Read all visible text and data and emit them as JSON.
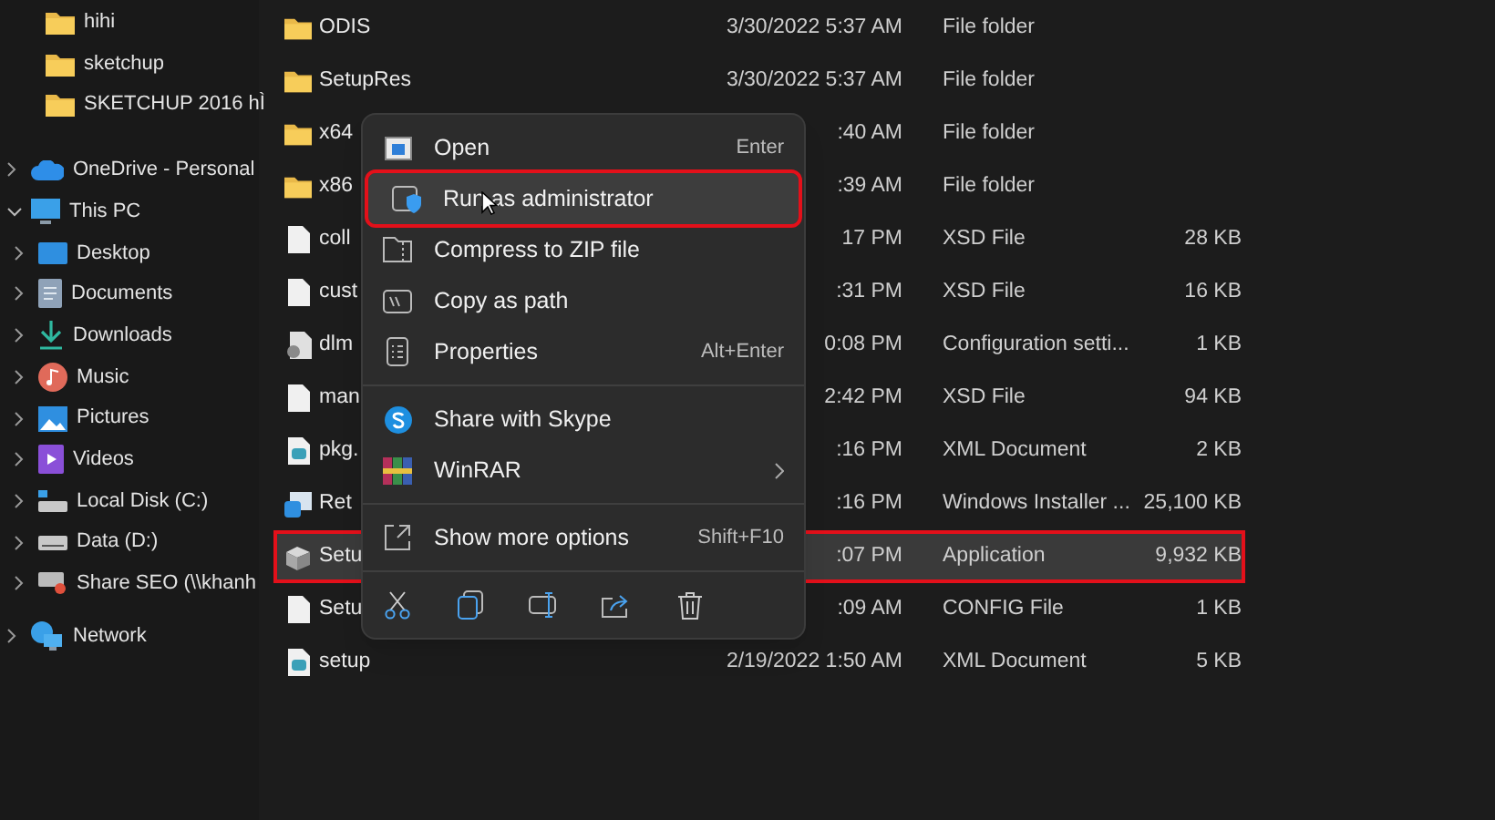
{
  "sidebar": {
    "top_items": [
      {
        "label": "hihi",
        "kind": "folder"
      },
      {
        "label": "sketchup",
        "kind": "folder"
      },
      {
        "label": "SKETCHUP 2016 hÌ",
        "kind": "folder"
      }
    ],
    "items": [
      {
        "label": "OneDrive - Personal",
        "kind": "cloud",
        "expanded": false
      },
      {
        "label": "This PC",
        "kind": "pc",
        "expanded": true,
        "children": [
          {
            "label": "Desktop",
            "kind": "desktop",
            "expanded": false
          },
          {
            "label": "Documents",
            "kind": "documents",
            "expanded": false
          },
          {
            "label": "Downloads",
            "kind": "downloads",
            "expanded": false
          },
          {
            "label": "Music",
            "kind": "music",
            "expanded": false
          },
          {
            "label": "Pictures",
            "kind": "pictures",
            "expanded": false
          },
          {
            "label": "Videos",
            "kind": "videos",
            "expanded": false
          },
          {
            "label": "Local Disk (C:)",
            "kind": "disk",
            "expanded": false
          },
          {
            "label": "Data (D:)",
            "kind": "drive",
            "expanded": false
          },
          {
            "label": "Share SEO (\\\\khanh",
            "kind": "netdrive",
            "expanded": false
          }
        ]
      },
      {
        "label": "Network",
        "kind": "network",
        "expanded": false
      }
    ]
  },
  "files": [
    {
      "name": "ODIS",
      "date": "3/30/2022 5:37 AM",
      "type": "File folder",
      "kind": "folder",
      "selected": false
    },
    {
      "name": "SetupRes",
      "date": "3/30/2022 5:37 AM",
      "type": "File folder",
      "kind": "folder",
      "selected": false
    },
    {
      "name": "x64",
      "date": ":40 AM",
      "type": "File folder",
      "kind": "folder",
      "selected": false
    },
    {
      "name": "x86",
      "date": ":39 AM",
      "type": "File folder",
      "kind": "folder",
      "selected": false
    },
    {
      "name": "coll",
      "date": "17 PM",
      "type": "XSD File",
      "size": "28 KB",
      "kind": "file",
      "selected": false
    },
    {
      "name": "cust",
      "date": ":31 PM",
      "type": "XSD File",
      "size": "16 KB",
      "kind": "file",
      "selected": false
    },
    {
      "name": "dlm",
      "date": "0:08 PM",
      "type": "Configuration setti...",
      "size": "1 KB",
      "kind": "config",
      "selected": false
    },
    {
      "name": "man",
      "date": "2:42 PM",
      "type": "XSD File",
      "size": "94 KB",
      "kind": "file",
      "selected": false
    },
    {
      "name": "pkg.",
      "date": ":16 PM",
      "type": "XML Document",
      "size": "2 KB",
      "kind": "xml",
      "selected": false
    },
    {
      "name": "Ret",
      "date": ":16 PM",
      "type": "Windows Installer ...",
      "size": "25,100 KB",
      "kind": "msi",
      "selected": false
    },
    {
      "name": "Setu",
      "date": ":07 PM",
      "type": "Application",
      "size": "9,932 KB",
      "kind": "exe",
      "selected": true,
      "highlighted": true
    },
    {
      "name": "Setu",
      "date": ":09 AM",
      "type": "CONFIG File",
      "size": "1 KB",
      "kind": "file",
      "selected": false
    },
    {
      "name": "setup",
      "date": "2/19/2022 1:50 AM",
      "type": "XML Document",
      "size": "5 KB",
      "kind": "xml",
      "selected": false
    }
  ],
  "context_menu": {
    "groups": [
      [
        {
          "label": "Open",
          "shortcut": "Enter",
          "kind": "open",
          "hovered": false
        },
        {
          "label": "Run as administrator",
          "kind": "admin",
          "hovered": true,
          "highlighted": true
        },
        {
          "label": "Compress to ZIP file",
          "kind": "zip",
          "hovered": false
        },
        {
          "label": "Copy as path",
          "kind": "path",
          "hovered": false
        },
        {
          "label": "Properties",
          "shortcut": "Alt+Enter",
          "kind": "properties",
          "hovered": false
        }
      ],
      [
        {
          "label": "Share with Skype",
          "kind": "skype",
          "hovered": false
        },
        {
          "label": "WinRAR",
          "kind": "winrar",
          "hovered": false,
          "submenu": true
        }
      ],
      [
        {
          "label": "Show more options",
          "shortcut": "Shift+F10",
          "kind": "more",
          "hovered": false
        }
      ]
    ]
  }
}
